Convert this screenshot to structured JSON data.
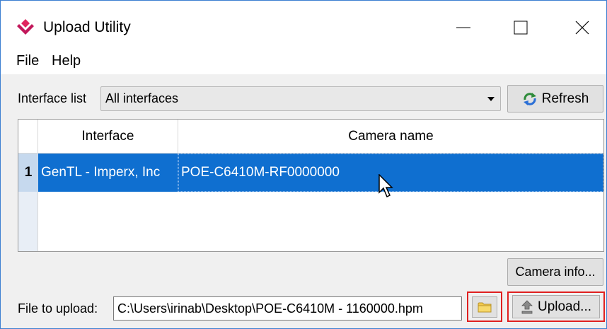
{
  "window": {
    "title": "Upload Utility",
    "accent_color": "#e0245e"
  },
  "menu": {
    "items": [
      "File",
      "Help"
    ]
  },
  "interface": {
    "label": "Interface list",
    "selected": "All interfaces"
  },
  "buttons": {
    "refresh": "Refresh",
    "camera_info": "Camera info...",
    "upload": "Upload..."
  },
  "table": {
    "columns": [
      "Interface",
      "Camera name"
    ],
    "rows": [
      {
        "number": "1",
        "interface": "GenTL - Imperx, Inc",
        "camera": "POE-C6410M-RF0000000",
        "selected": true
      }
    ],
    "selection_color": "#0f6fd0"
  },
  "upload": {
    "label": "File to upload:",
    "path": "C:\\Users\\irinab\\Desktop\\POE-C6410M - 1160000.hpm"
  },
  "icons": {
    "app": "app-logo-icon",
    "refresh": "refresh-icon",
    "browse": "folder-icon",
    "upload": "upload-icon"
  }
}
